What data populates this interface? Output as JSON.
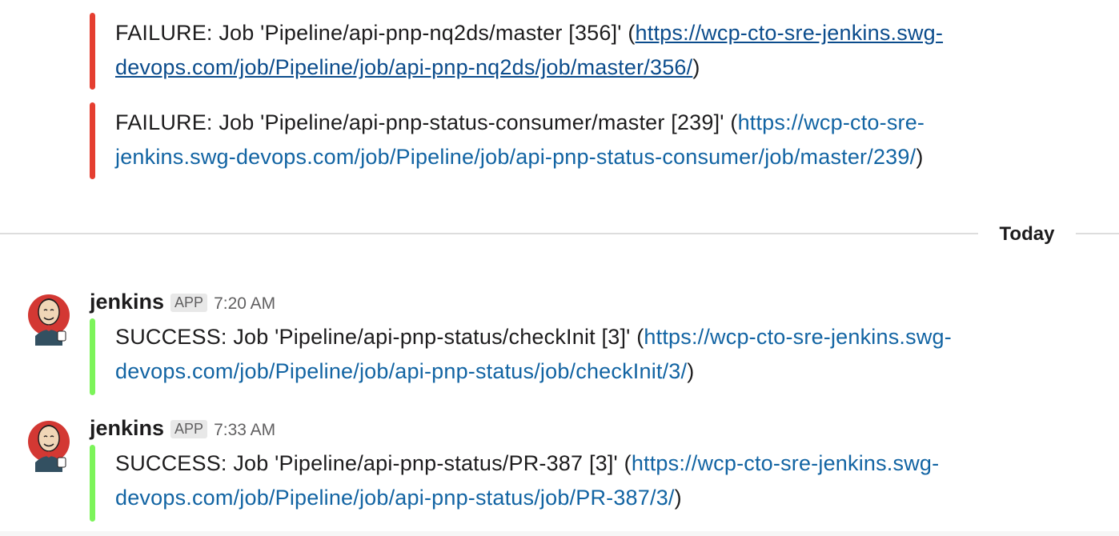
{
  "colors": {
    "failure": "#e53e30",
    "success": "#7cf45a",
    "link": "#1264a3",
    "divider": "#dddddd"
  },
  "attachments": [
    {
      "status": "failure",
      "text_prefix": "FAILURE: Job 'Pipeline/api-pnp-nq2ds/master [356]' (",
      "link": "https://wcp-cto-sre-jenkins.swg-devops.com/job/Pipeline/job/api-pnp-nq2ds/job/master/356/",
      "text_suffix": ")"
    },
    {
      "status": "failure",
      "text_prefix": "FAILURE: Job 'Pipeline/api-pnp-status-consumer/master [239]' (",
      "link": "https://wcp-cto-sre-jenkins.swg-devops.com/job/Pipeline/job/api-pnp-status-consumer/job/master/239/",
      "text_suffix": ")"
    }
  ],
  "day_divider": {
    "label": "Today"
  },
  "messages": [
    {
      "sender": "jenkins",
      "badge": "APP",
      "time": "7:20 AM",
      "avatar_icon": "jenkins-butler-icon",
      "attachment": {
        "status": "success",
        "text_prefix": "SUCCESS: Job 'Pipeline/api-pnp-status/checkInit [3]' (",
        "link": "https://wcp-cto-sre-jenkins.swg-devops.com/job/Pipeline/job/api-pnp-status/job/checkInit/3/",
        "text_suffix": ")"
      }
    },
    {
      "sender": "jenkins",
      "badge": "APP",
      "time": "7:33 AM",
      "avatar_icon": "jenkins-butler-icon",
      "attachment": {
        "status": "success",
        "text_prefix": "SUCCESS: Job 'Pipeline/api-pnp-status/PR-387 [3]' (",
        "link": "https://wcp-cto-sre-jenkins.swg-devops.com/job/Pipeline/job/api-pnp-status/job/PR-387/3/",
        "text_suffix": ")"
      }
    }
  ]
}
